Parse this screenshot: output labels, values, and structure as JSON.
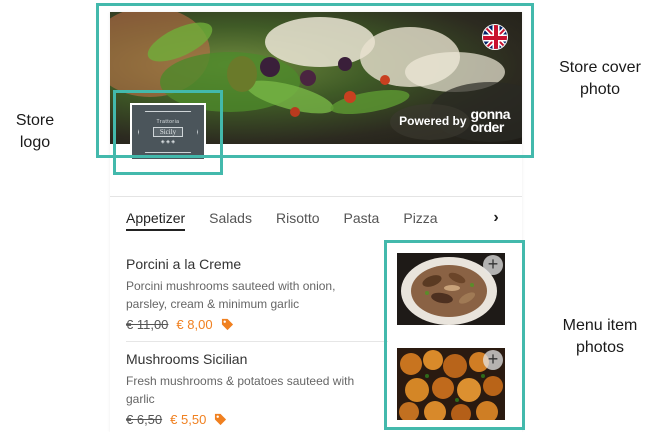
{
  "annotations": {
    "logo": "Store logo",
    "cover": "Store cover photo",
    "photos": "Menu item photos"
  },
  "store": {
    "logo_small": "Trattoria",
    "logo_name": "Sicily",
    "logo_dots": "◈ ◈ ◈",
    "powered_by": "Powered by",
    "brand_line1": "gonna",
    "brand_line2": "order",
    "language_flag": "uk-flag-icon"
  },
  "tabs": [
    "Appetizer",
    "Salads",
    "Risotto",
    "Pasta",
    "Pizza"
  ],
  "tab_next_icon": "chevron-right-icon",
  "items": [
    {
      "title": "Porcini a la Creme",
      "description": "Porcini mushrooms sauteed with onion, parsley, cream & minimum garlic",
      "old_price": "€ 11,00",
      "new_price": "€ 8,00"
    },
    {
      "title": "Mushrooms Sicilian",
      "description": "Fresh mushrooms & potatoes sauteed with garlic",
      "old_price": "€ 6,50",
      "new_price": "€ 5,50"
    }
  ],
  "add_icon": "+",
  "colors": {
    "accent": "#43b9ac",
    "price": "#f08020"
  }
}
